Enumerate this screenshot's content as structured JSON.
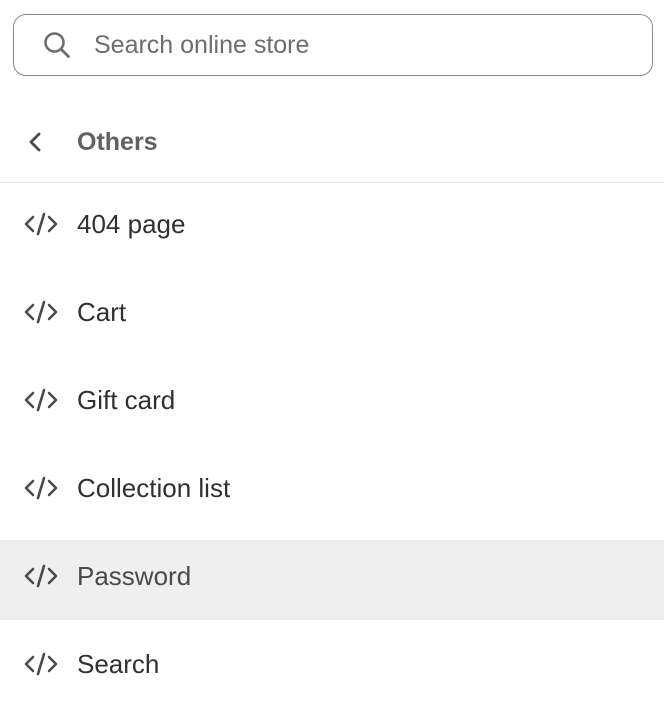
{
  "search": {
    "placeholder": "Search online store",
    "value": ""
  },
  "header": {
    "title": "Others",
    "back_icon": "chevron-left-icon"
  },
  "items": [
    {
      "label": "404 page",
      "icon": "code-icon",
      "selected": false
    },
    {
      "label": "Cart",
      "icon": "code-icon",
      "selected": false
    },
    {
      "label": "Gift card",
      "icon": "code-icon",
      "selected": false
    },
    {
      "label": "Collection list",
      "icon": "code-icon",
      "selected": false
    },
    {
      "label": "Password",
      "icon": "code-icon",
      "selected": true
    },
    {
      "label": "Search",
      "icon": "code-icon",
      "selected": false
    }
  ],
  "colors": {
    "text": "#303030",
    "muted_text": "#616161",
    "border": "#8a8a8a",
    "divider": "#e3e3e3",
    "selected_bg": "#efefef"
  }
}
